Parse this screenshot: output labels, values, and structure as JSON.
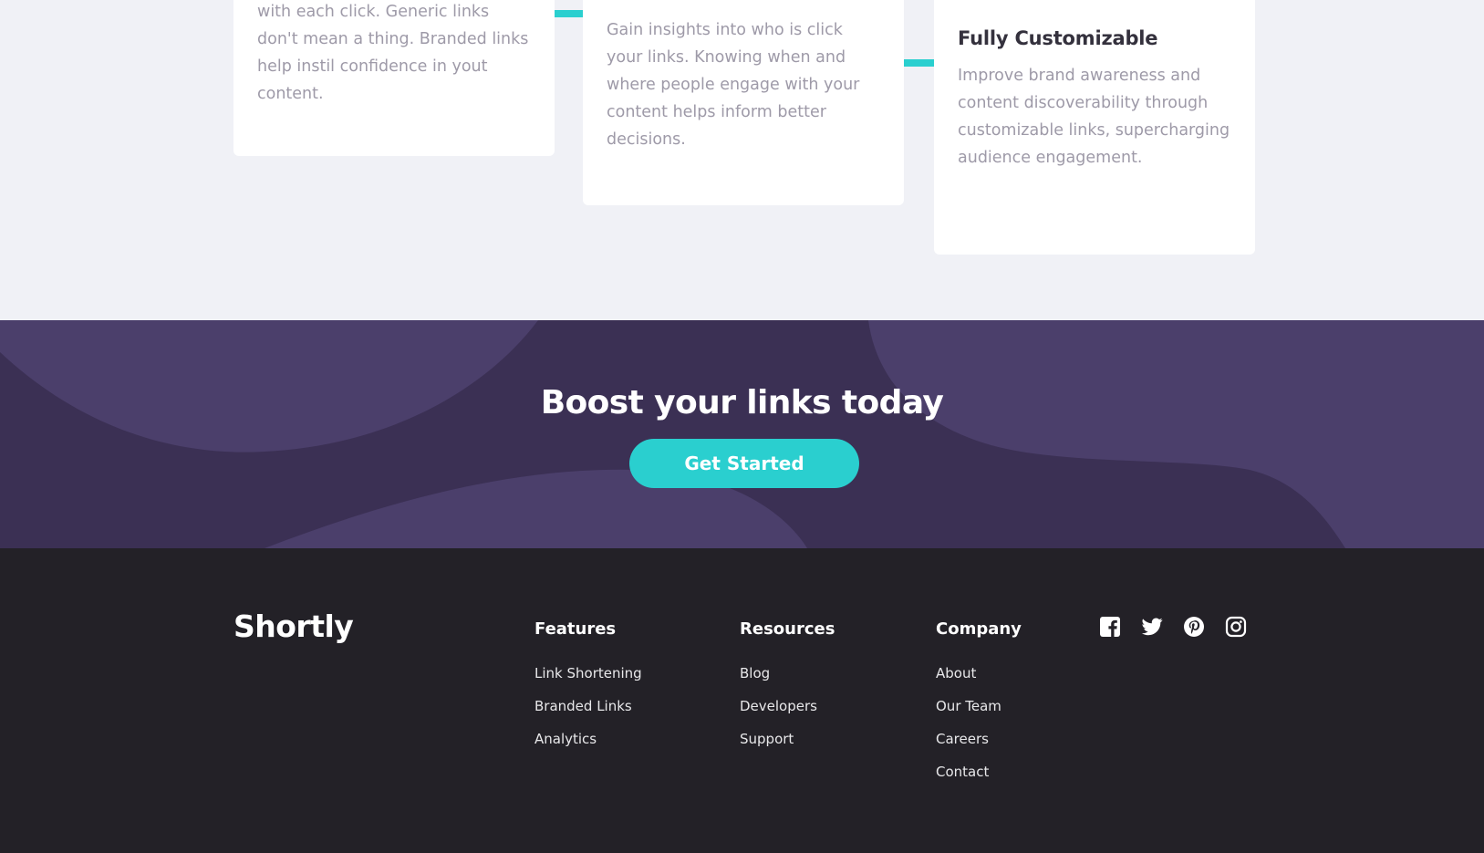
{
  "stats": {
    "cards": [
      {
        "title": "",
        "description": "with each click. Generic links don't mean a thing. Branded links help instil confidence in yout content."
      },
      {
        "title": "",
        "description": "Gain insights into who is click your links. Knowing when and where people engage with your content helps inform better decisions."
      },
      {
        "title": "Fully Customizable",
        "description": "Improve brand awareness and content discoverability through customizable links, supercharging audience engagement."
      }
    ]
  },
  "boost": {
    "heading": "Boost your links today",
    "button_label": "Get Started"
  },
  "footer": {
    "logo": "Shortly",
    "columns": [
      {
        "title": "Features",
        "links": [
          "Link Shortening",
          "Branded Links",
          "Analytics"
        ]
      },
      {
        "title": "Resources",
        "links": [
          "Blog",
          "Developers",
          "Support"
        ]
      },
      {
        "title": "Company",
        "links": [
          "About",
          "Our Team",
          "Careers",
          "Contact"
        ]
      }
    ],
    "socials": [
      "facebook-icon",
      "twitter-icon",
      "pinterest-icon",
      "instagram-icon"
    ]
  },
  "colors": {
    "accent": "#2acfcf",
    "dark_violet": "#3b3054",
    "footer_bg": "#232127",
    "page_bg": "#f0f1f6",
    "text_gray": "#9e9aa8"
  }
}
